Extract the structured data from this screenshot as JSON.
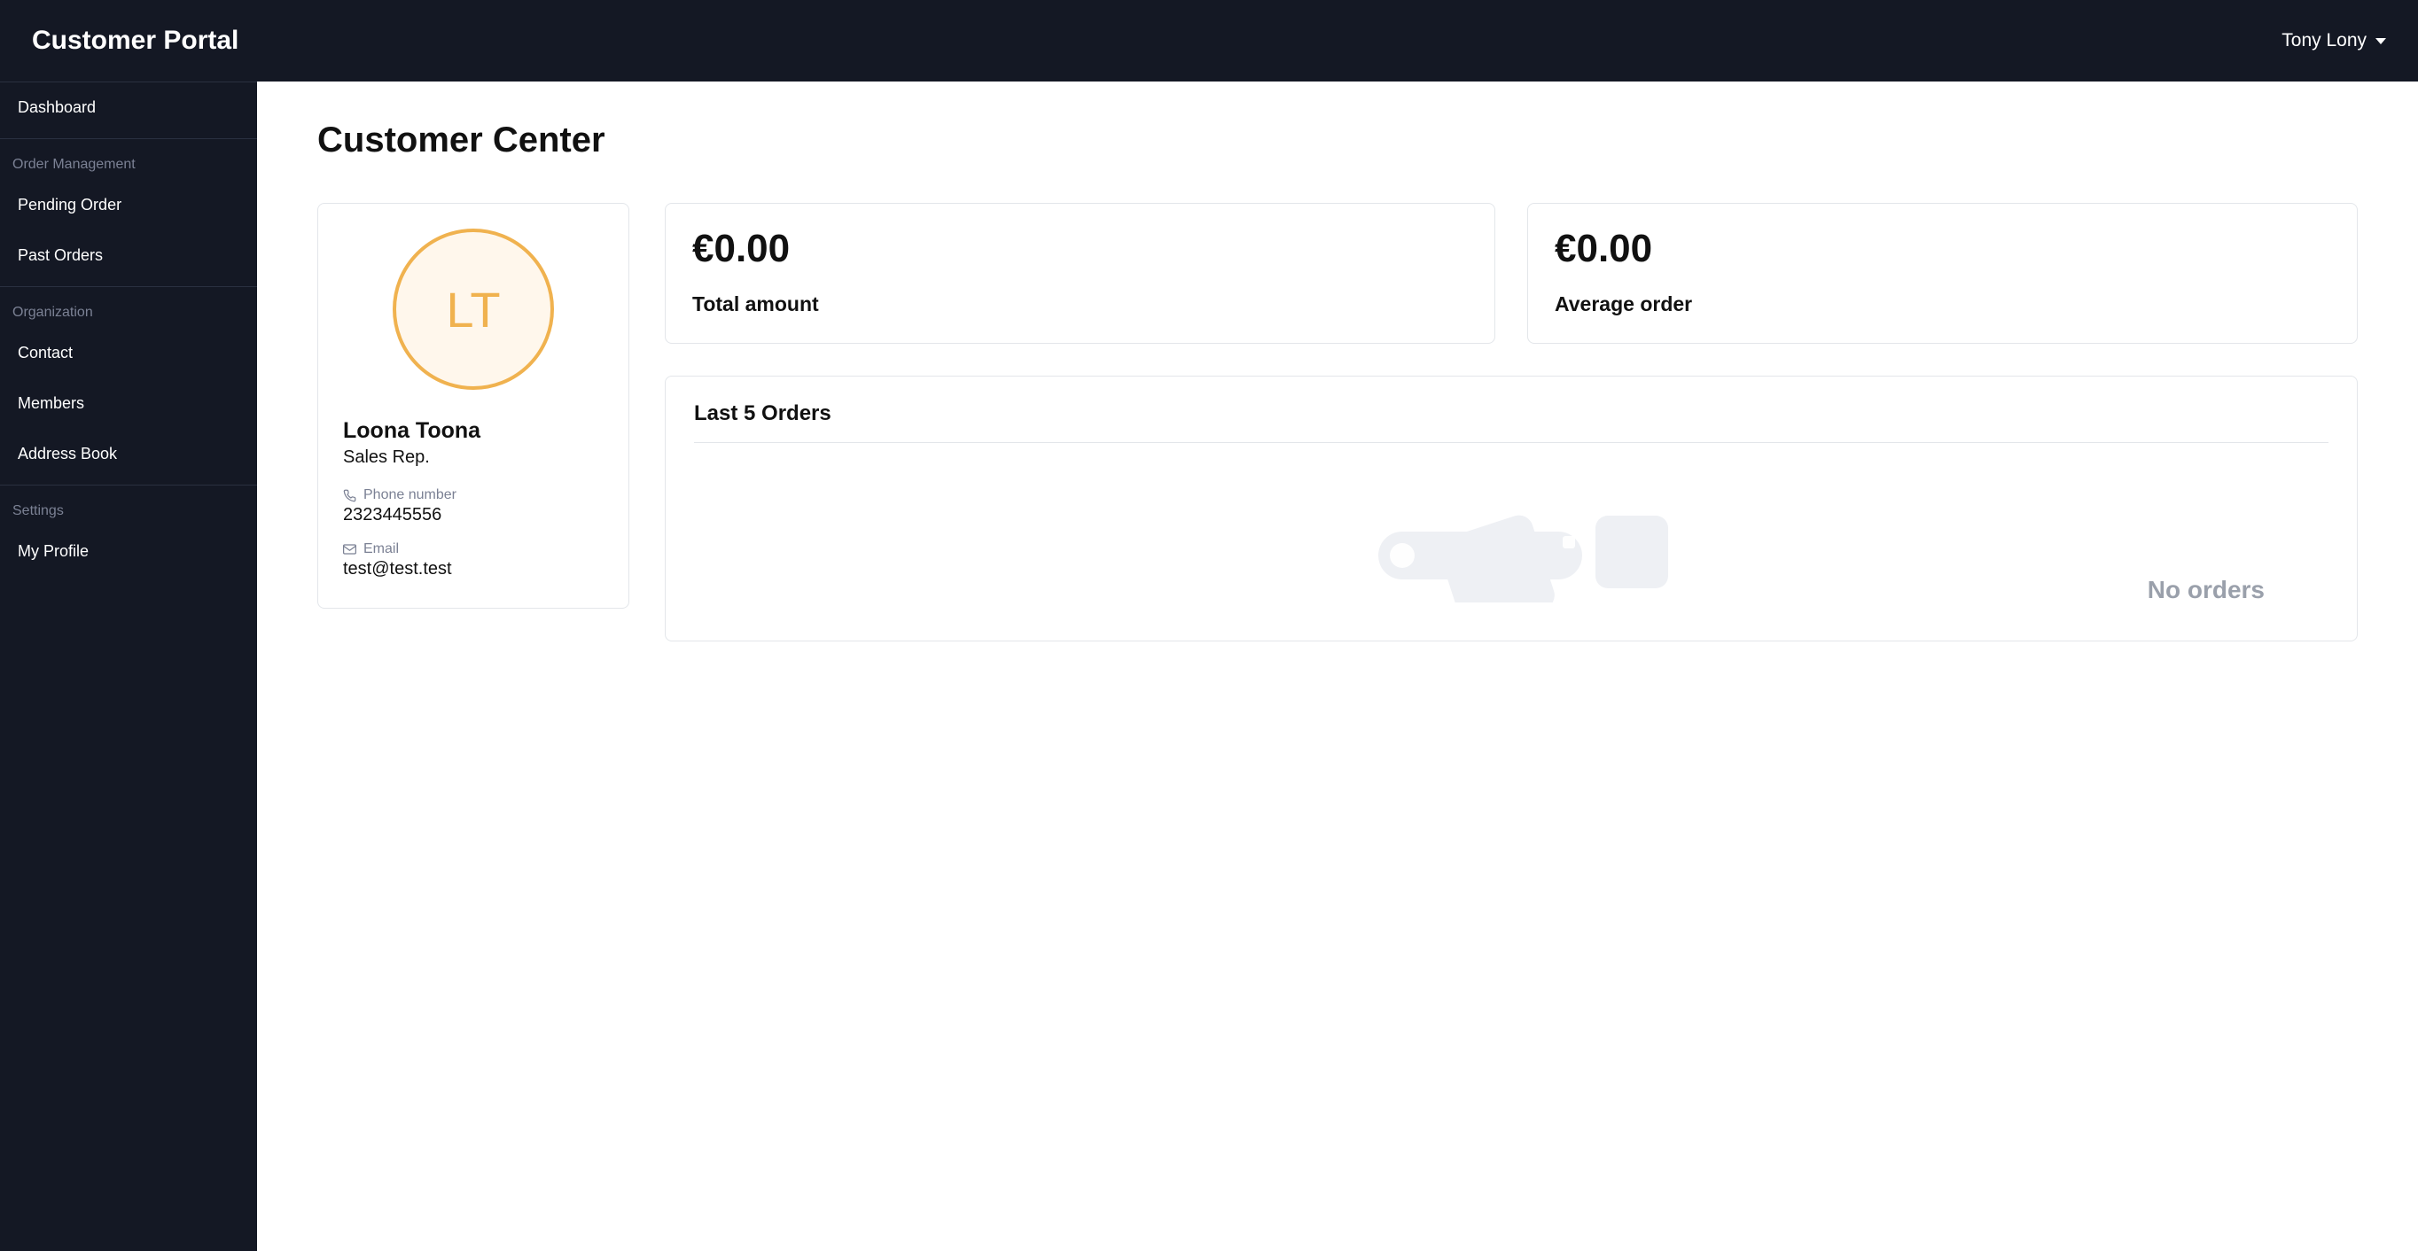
{
  "header": {
    "title": "Customer Portal",
    "user": "Tony Lony"
  },
  "sidebar": {
    "dashboard": "Dashboard",
    "section_order_management": "Order Management",
    "pending_order": "Pending Order",
    "past_orders": "Past Orders",
    "section_organization": "Organization",
    "contact": "Contact",
    "members": "Members",
    "address_book": "Address Book",
    "section_settings": "Settings",
    "my_profile": "My Profile"
  },
  "page": {
    "title": "Customer Center"
  },
  "rep": {
    "initials": "LT",
    "name": "Loona Toona",
    "role": "Sales Rep.",
    "phone_label": "Phone number",
    "phone": "2323445556",
    "email_label": "Email",
    "email": "test@test.test"
  },
  "stats": {
    "total_amount_value": "€0.00",
    "total_amount_label": "Total amount",
    "average_order_value": "€0.00",
    "average_order_label": "Average order"
  },
  "orders": {
    "heading": "Last 5 Orders",
    "empty_text": "No orders"
  }
}
